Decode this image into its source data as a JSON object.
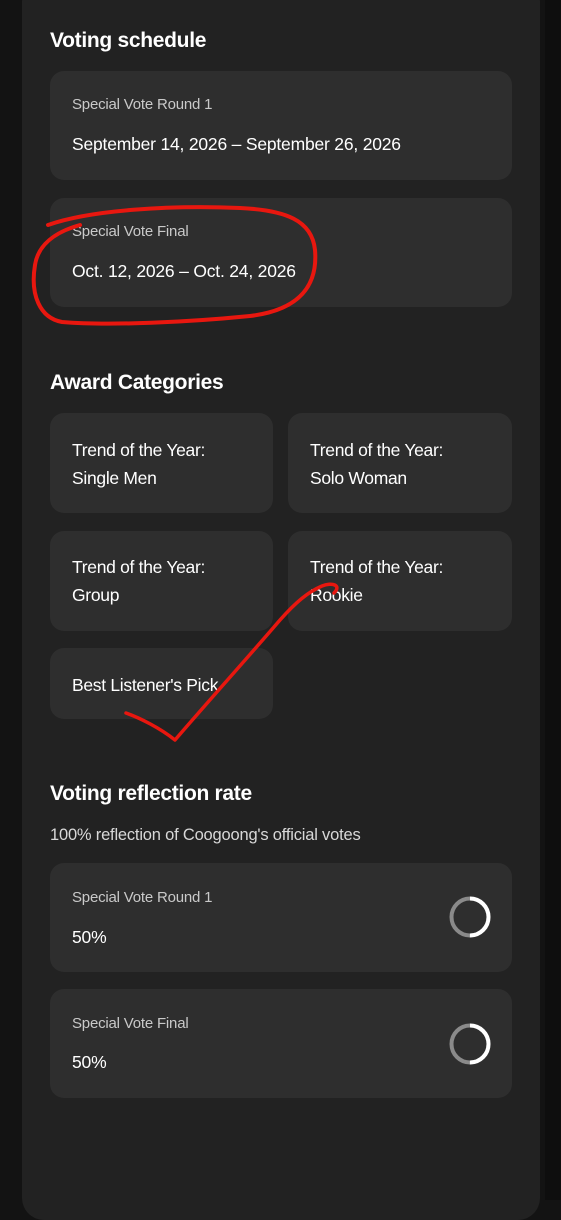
{
  "schedule": {
    "title": "Voting schedule",
    "items": [
      {
        "label": "Special Vote Round 1",
        "dates": "September 14, 2026 – September 26, 2026"
      },
      {
        "label": "Special Vote Final",
        "dates": "Oct. 12, 2026 – Oct. 24, 2026"
      }
    ]
  },
  "categories": {
    "title": "Award Categories",
    "items": [
      {
        "line1": "Trend of the Year:",
        "line2": "Single Men"
      },
      {
        "line1": "Trend of the Year:",
        "line2": "Solo Woman"
      },
      {
        "line1": "Trend of the Year:",
        "line2": "Group"
      },
      {
        "line1": "Trend of the Year:",
        "line2": "Rookie"
      },
      {
        "line1": "Best Listener's Pick",
        "line2": ""
      }
    ]
  },
  "reflection": {
    "title": "Voting reflection rate",
    "subtitle": "100% reflection of Coogoong's official votes",
    "items": [
      {
        "label": "Special Vote Round 1",
        "value": "50%",
        "ring_fraction": 0.5,
        "icon": "progress-ring-icon"
      },
      {
        "label": "Special Vote Final",
        "value": "50%",
        "ring_fraction": 0.5,
        "icon": "progress-ring-icon"
      }
    ]
  },
  "colors": {
    "background": "#131313",
    "panel": "#222222",
    "card": "#2e2e2e",
    "annotation": "#e8170f"
  }
}
